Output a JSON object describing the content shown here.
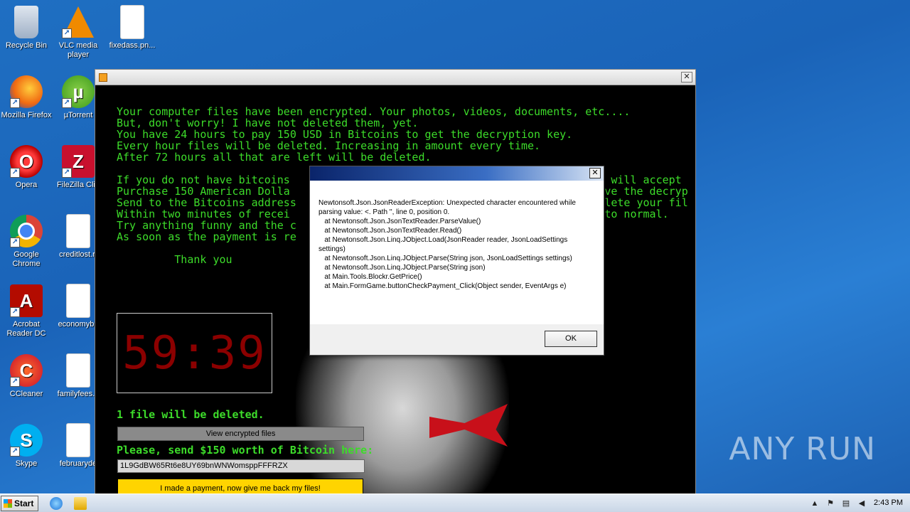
{
  "desktop": {
    "icons": [
      {
        "label": "Recycle Bin"
      },
      {
        "label": "VLC media player"
      },
      {
        "label": "fixedass.pn..."
      },
      {
        "label": "Mozilla Firefox"
      },
      {
        "label": "µTorrent"
      },
      {
        "label": "Opera"
      },
      {
        "label": "FileZilla Clie"
      },
      {
        "label": "Google Chrome"
      },
      {
        "label": "creditlost.rt"
      },
      {
        "label": "Acrobat Reader DC"
      },
      {
        "label": "economybu"
      },
      {
        "label": "CCleaner"
      },
      {
        "label": "familyfees.p"
      },
      {
        "label": "Skype"
      },
      {
        "label": "februaryde"
      }
    ],
    "watermark": "ANY RUN"
  },
  "ransom_window": {
    "message_lines": "Your computer files have been encrypted. Your photos, videos, documents, etc....\nBut, don't worry! I have not deleted them, yet.\nYou have 24 hours to pay 150 USD in Bitcoins to get the decryption key.\nEvery hour files will be deleted. Increasing in amount every time.\nAfter 72 hours all that are left will be deleted.\n\nIf you do not have bitcoins                                                  will accept\nPurchase 150 American Dolla                                                 ve the decryp\nSend to the Bitcoins address                                                lete your fil\nWithin two minutes of recei                                                 to normal.\nTry anything funny and the c\nAs soon as the payment is re\n\n         Thank you",
    "timer": "59:39",
    "files_deleted": "1 file will be deleted.",
    "view_button": "View encrypted files",
    "send_label": "Please, send $150 worth of Bitcoin here:",
    "bitcoin_address": "1L9GdBW65Rt6e8UY69bnWNWomsppFFFRZX",
    "payment_button": "I made a payment, now give me back my files!"
  },
  "dialog": {
    "message": "Newtonsoft.Json.JsonReaderException: Unexpected character encountered while parsing value: <. Path '', line 0, position 0.\n   at Newtonsoft.Json.JsonTextReader.ParseValue()\n   at Newtonsoft.Json.JsonTextReader.Read()\n   at Newtonsoft.Json.Linq.JObject.Load(JsonReader reader, JsonLoadSettings settings)\n   at Newtonsoft.Json.Linq.JObject.Parse(String json, JsonLoadSettings settings)\n   at Newtonsoft.Json.Linq.JObject.Parse(String json)\n   at Main.Tools.Blockr.GetPrice()\n   at Main.FormGame.buttonCheckPayment_Click(Object sender, EventArgs e)",
    "ok_button": "OK",
    "close_glyph": "✕"
  },
  "taskbar": {
    "start_label": "Start",
    "clock": "2:43 PM"
  }
}
